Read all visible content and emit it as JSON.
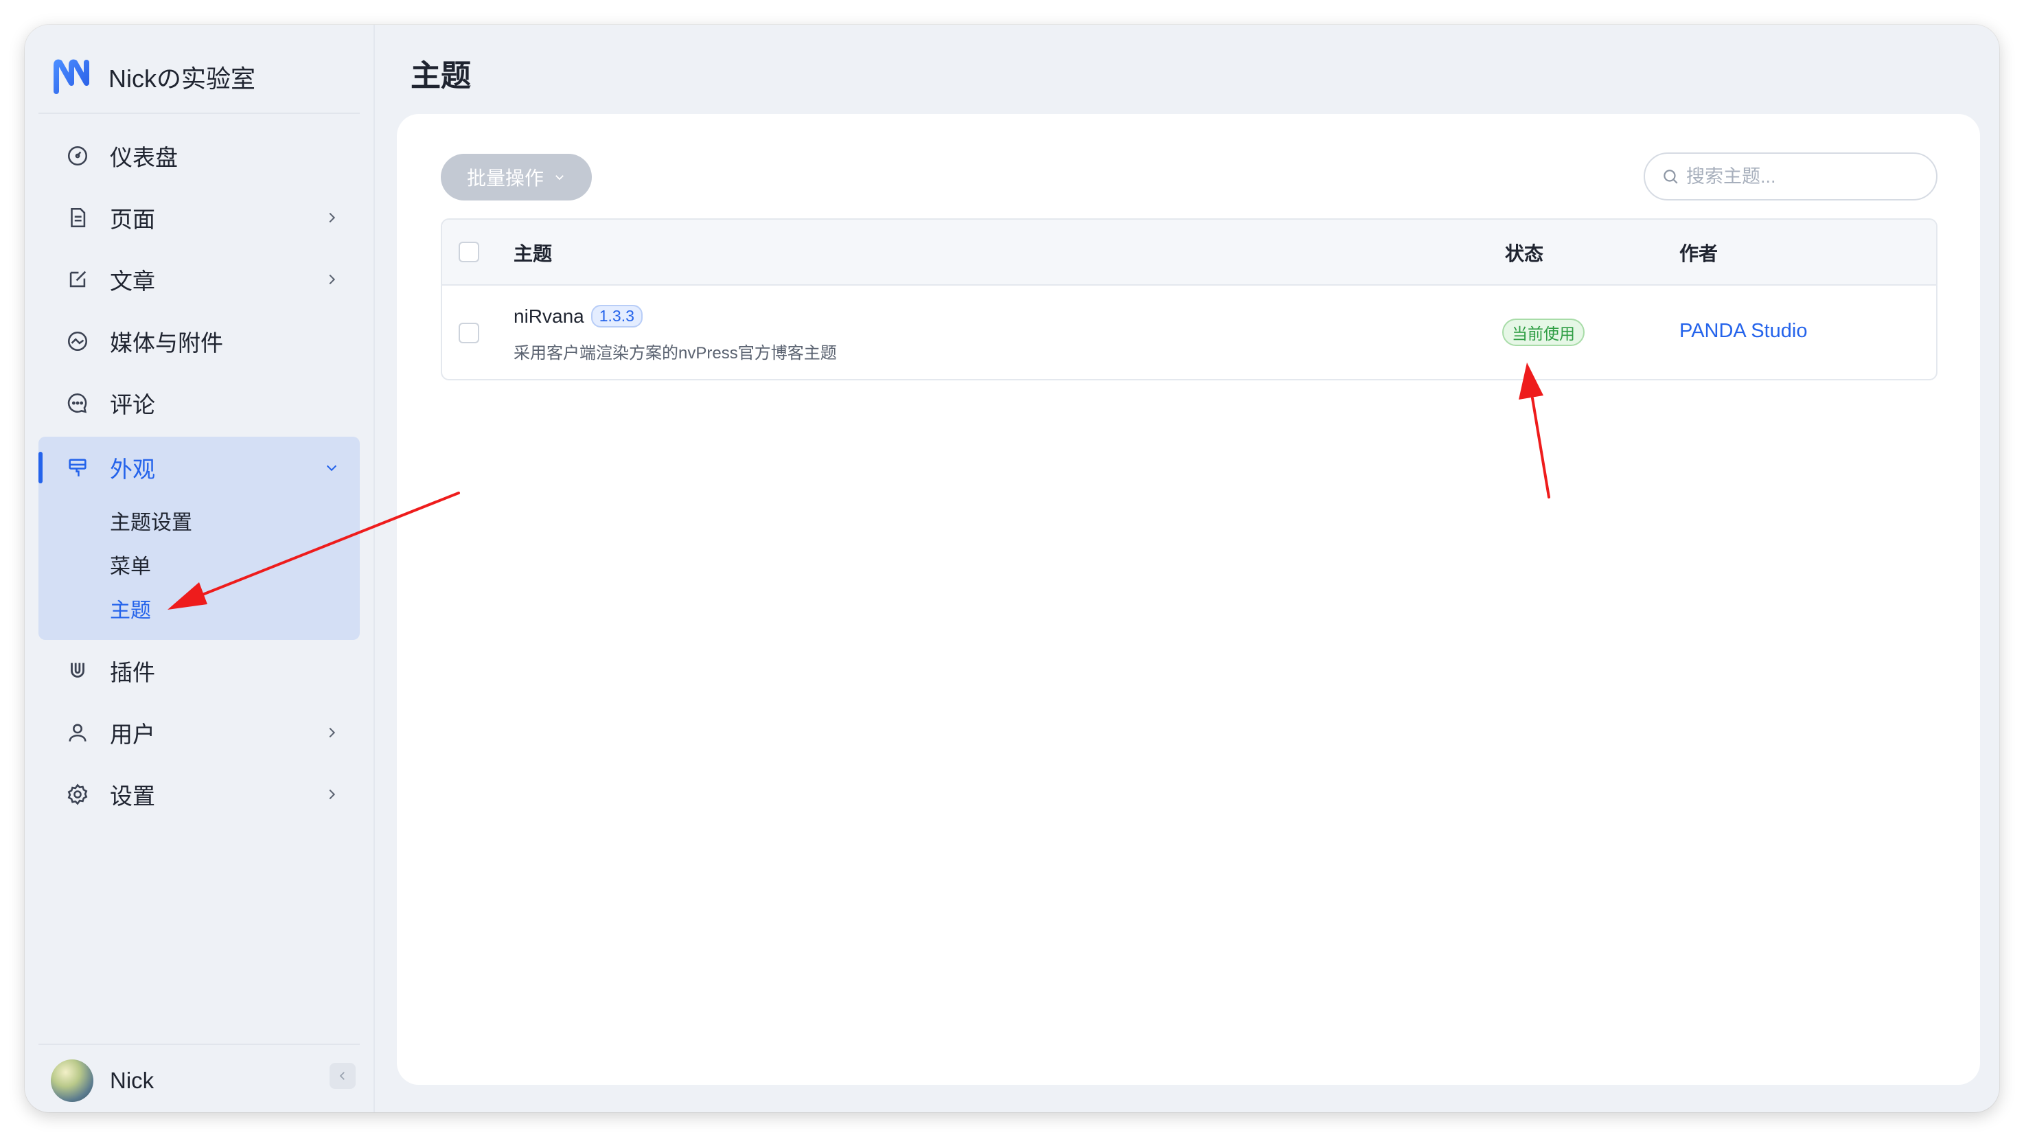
{
  "brand": {
    "name": "Nickの实验室"
  },
  "sidebar": {
    "items": [
      {
        "label": "仪表盘",
        "icon": "dashboard-icon"
      },
      {
        "label": "页面",
        "icon": "page-icon",
        "has_children": true
      },
      {
        "label": "文章",
        "icon": "edit-icon",
        "has_children": true
      },
      {
        "label": "媒体与附件",
        "icon": "media-icon"
      },
      {
        "label": "评论",
        "icon": "comment-icon"
      }
    ],
    "appearance": {
      "label": "外观",
      "icon": "appearance-icon",
      "children": [
        {
          "label": "主题设置"
        },
        {
          "label": "菜单"
        },
        {
          "label": "主题"
        }
      ]
    },
    "items_after": [
      {
        "label": "插件",
        "icon": "plugin-icon"
      },
      {
        "label": "用户",
        "icon": "user-icon",
        "has_children": true
      },
      {
        "label": "设置",
        "icon": "settings-icon",
        "has_children": true
      }
    ]
  },
  "user": {
    "name": "Nick"
  },
  "page": {
    "title": "主题"
  },
  "toolbar": {
    "bulk_label": "批量操作",
    "search_placeholder": "搜索主题..."
  },
  "table": {
    "columns": {
      "theme": "主题",
      "status": "状态",
      "author": "作者"
    },
    "rows": [
      {
        "name": "niRvana",
        "version": "1.3.3",
        "description": "采用客户端渲染方案的nvPress官方博客主题",
        "status": "当前使用",
        "author": "PANDA Studio"
      }
    ]
  },
  "colors": {
    "accent": "#2463eb",
    "status_green": "#2f9e44",
    "annotation_arrow": "#ee1c1c"
  }
}
